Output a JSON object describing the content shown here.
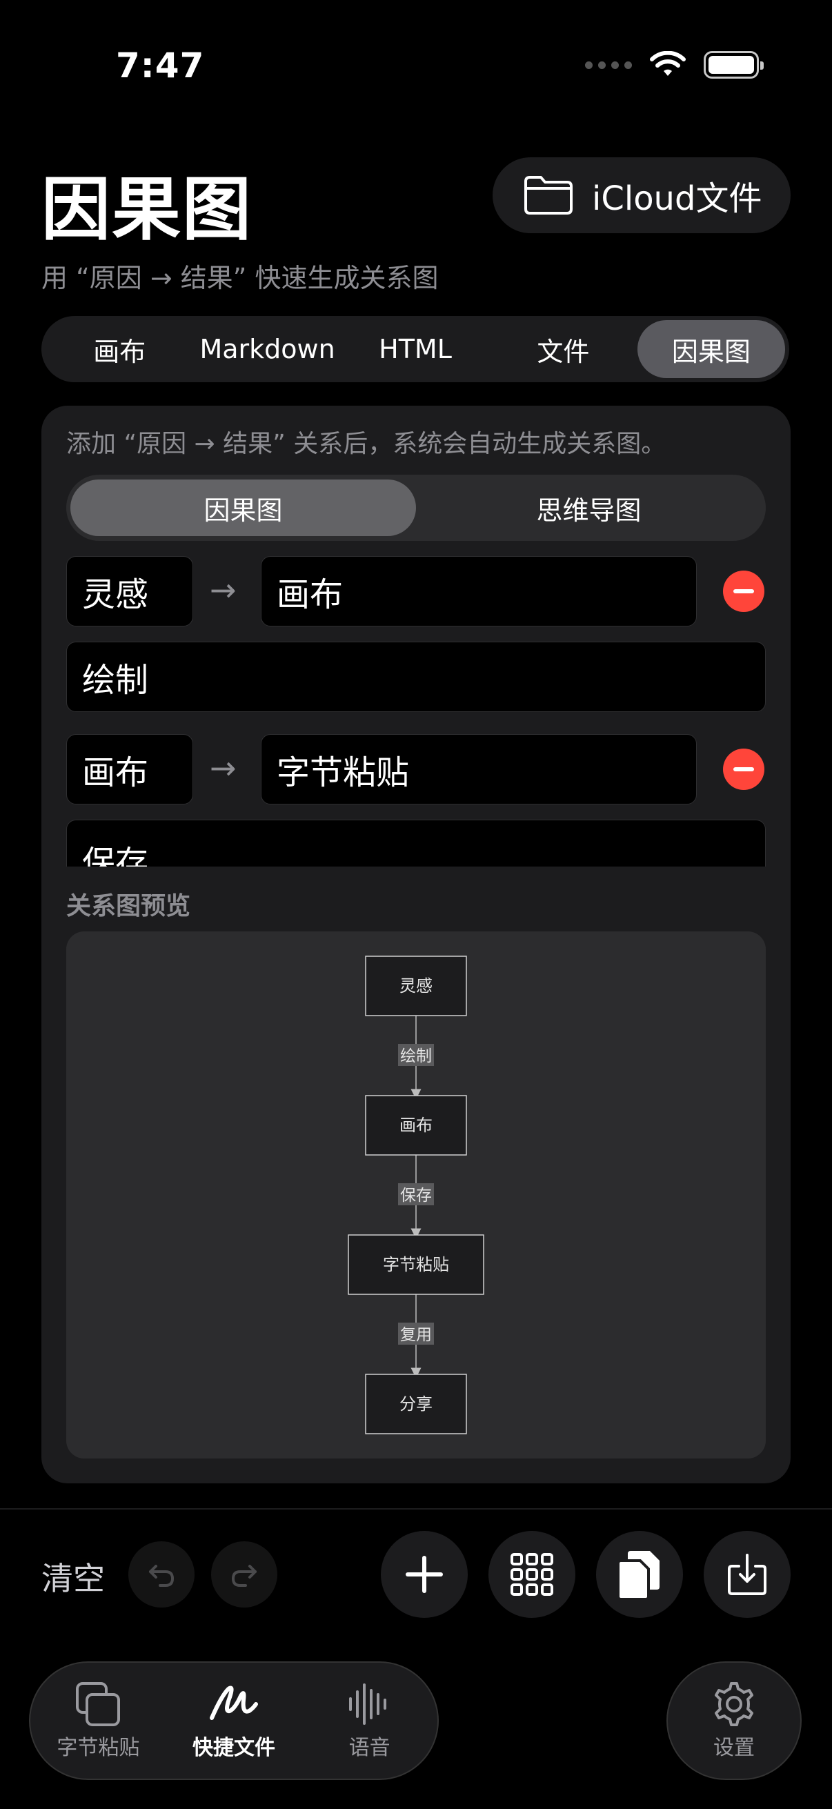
{
  "status_bar": {
    "time": "7:47"
  },
  "header": {
    "title": "因果图",
    "subtitle": "用 “原因 → 结果” 快速生成关系图",
    "icloud_button": "iCloud文件"
  },
  "tabs": [
    {
      "label": "画布",
      "active": false
    },
    {
      "label": "Markdown",
      "active": false
    },
    {
      "label": "HTML",
      "active": false
    },
    {
      "label": "文件",
      "active": false
    },
    {
      "label": "因果图",
      "active": true
    }
  ],
  "card": {
    "hint": "添加 “原因 → 结果” 关系后，系统会自动生成关系图。",
    "mode_options": [
      {
        "label": "因果图",
        "active": true
      },
      {
        "label": "思维导图",
        "active": false
      }
    ],
    "relations": [
      {
        "cause": "灵感",
        "effect": "画布",
        "label": "绘制"
      },
      {
        "cause": "画布",
        "effect": "字节粘贴",
        "label": "保存"
      }
    ],
    "preview_label": "关系图预览"
  },
  "diagram": {
    "nodes": [
      "灵感",
      "画布",
      "字节粘贴",
      "分享"
    ],
    "edges": [
      {
        "from": "灵感",
        "to": "画布",
        "label": "绘制"
      },
      {
        "from": "画布",
        "to": "字节粘贴",
        "label": "保存"
      },
      {
        "from": "字节粘贴",
        "to": "分享",
        "label": "复用"
      }
    ]
  },
  "toolbar": {
    "clear_label": "清空",
    "icons": [
      "undo-icon",
      "redo-icon",
      "plus-icon",
      "grid-icon",
      "copy-icon",
      "export-icon"
    ]
  },
  "tabbar": {
    "items": [
      {
        "label": "字节粘贴",
        "icon": "paste-icon",
        "active": false
      },
      {
        "label": "快捷文件",
        "icon": "scribble-icon",
        "active": true
      },
      {
        "label": "语音",
        "icon": "waveform-icon",
        "active": false
      }
    ],
    "settings_label": "设置"
  },
  "colors": {
    "background": "#000000",
    "card": "#1c1c1e",
    "delete": "#ff453a",
    "secondary_text": "#8e8e93"
  }
}
